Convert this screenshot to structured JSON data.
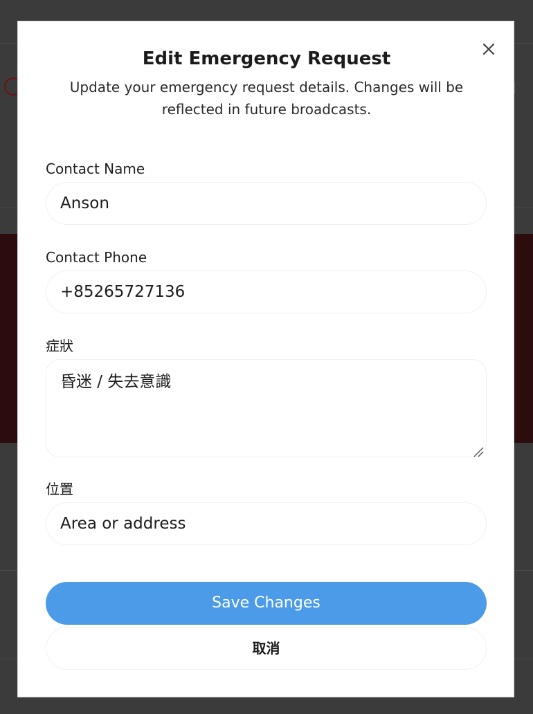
{
  "modal": {
    "title": "Edit Emergency Request",
    "subtitle": "Update your emergency request details. Changes will be reflected in future broadcasts.",
    "close_icon": "close-icon"
  },
  "fields": {
    "contact_name": {
      "label": "Contact Name",
      "value": "Anson"
    },
    "contact_phone": {
      "label": "Contact Phone",
      "value": "+85265727136"
    },
    "symptoms": {
      "label": "症狀",
      "value": "昏迷 / 失去意識"
    },
    "location": {
      "label": "位置",
      "value": "",
      "placeholder": "Area or address"
    }
  },
  "actions": {
    "save_label": "Save Changes",
    "cancel_label": "取消"
  },
  "colors": {
    "primary": "#4b9be8",
    "overlay": "#3b3b3b",
    "background_alert": "#2c0c0c"
  }
}
